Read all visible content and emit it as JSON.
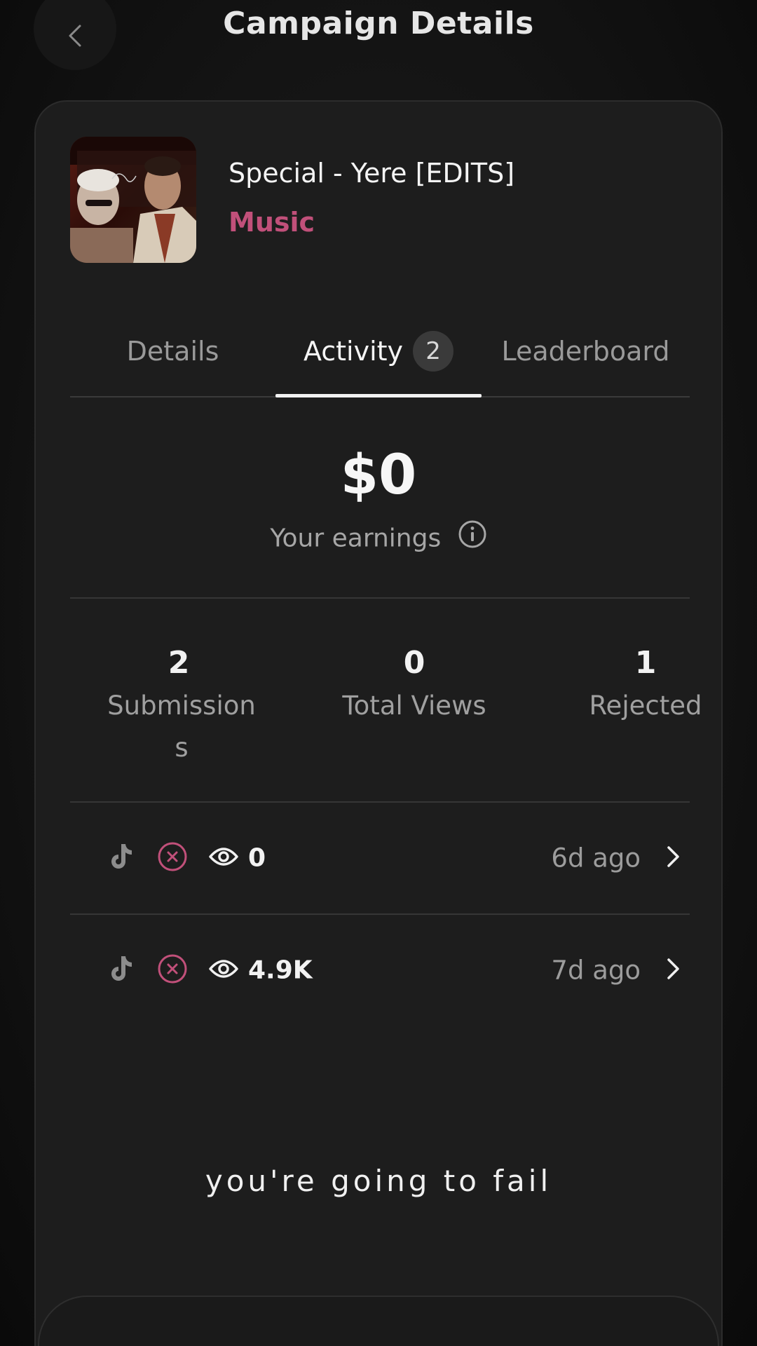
{
  "header": {
    "title": "Campaign Details",
    "back_icon": "chevron-left-icon"
  },
  "campaign": {
    "title": "Special - Yere [EDITS]",
    "category": "Music",
    "category_color": "#c1507a"
  },
  "tabs": [
    {
      "label": "Details",
      "active": false
    },
    {
      "label": "Activity",
      "active": true,
      "badge": "2"
    },
    {
      "label": "Leaderboard",
      "active": false
    }
  ],
  "earnings": {
    "value": "$0",
    "label": "Your earnings",
    "info_icon": "info-icon"
  },
  "stats": [
    {
      "value": "2",
      "label": "Submissions"
    },
    {
      "value": "0",
      "label": "Total Views"
    },
    {
      "value": "1",
      "label": "Rejected"
    }
  ],
  "submissions": [
    {
      "platform_icon": "tiktok-icon",
      "status_icon": "rejected-x-icon",
      "views": "0",
      "time": "6d ago"
    },
    {
      "platform_icon": "tiktok-icon",
      "status_icon": "rejected-x-icon",
      "views": "4.9K",
      "time": "7d ago"
    }
  ],
  "overlay_caption": "you're going to fail"
}
